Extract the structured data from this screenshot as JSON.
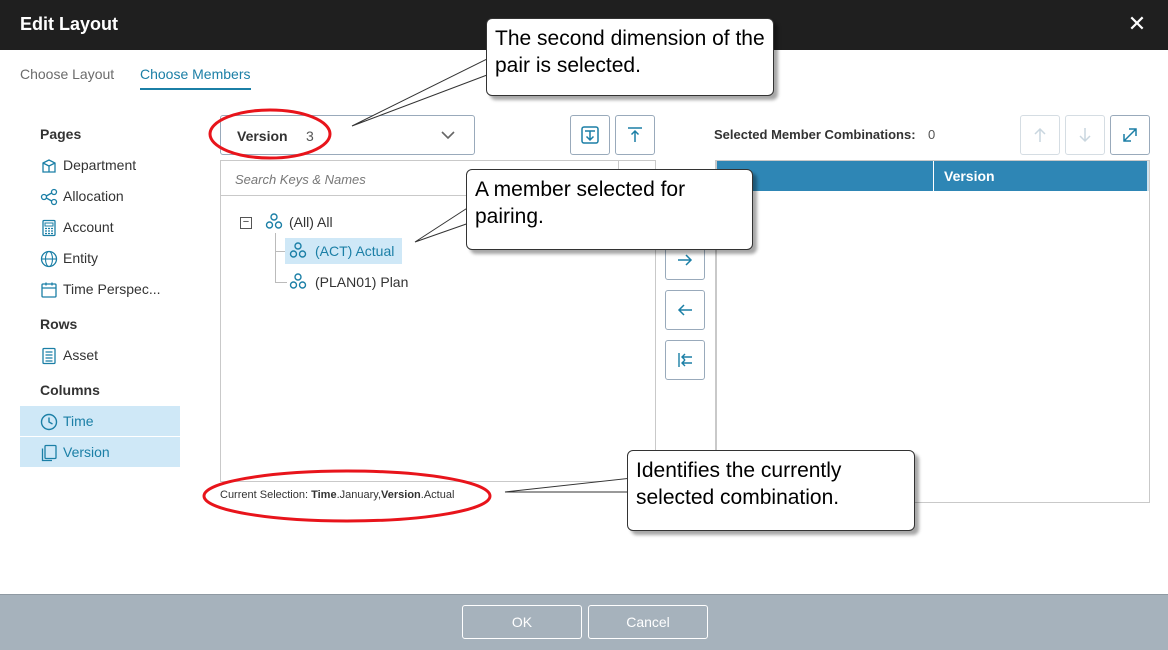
{
  "dialog": {
    "title": "Edit Layout",
    "close_glyph": "✕"
  },
  "tabs": {
    "choose_layout": "Choose Layout",
    "choose_members": "Choose Members"
  },
  "sidebar": {
    "pages_heading": "Pages",
    "pages": [
      {
        "label": "Department",
        "icon": "department-icon"
      },
      {
        "label": "Allocation",
        "icon": "allocation-icon"
      },
      {
        "label": "Account",
        "icon": "account-icon"
      },
      {
        "label": "Entity",
        "icon": "entity-icon"
      },
      {
        "label": "Time Perspec...",
        "icon": "calendar-icon"
      }
    ],
    "rows_heading": "Rows",
    "rows": [
      {
        "label": "Asset",
        "icon": "asset-icon"
      }
    ],
    "columns_heading": "Columns",
    "columns": [
      {
        "label": "Time",
        "icon": "clock-icon"
      },
      {
        "label": "Version",
        "icon": "version-icon"
      }
    ]
  },
  "dimension_dropdown": {
    "label": "Version",
    "count": "3"
  },
  "search": {
    "placeholder": "Search Keys & Names"
  },
  "tree": {
    "collapse_glyph": "−",
    "root": "(All) All",
    "children": [
      "(ACT) Actual",
      "(PLAN01) Plan"
    ]
  },
  "selected_combinations": {
    "label": "Selected Member Combinations:",
    "count": "0"
  },
  "grid": {
    "columns": [
      "",
      "Version"
    ]
  },
  "current_selection": {
    "prefix": "Current Selection: ",
    "dim1": "Time",
    "mem1": ".January,",
    "dim2": "Version",
    "mem2": ".Actual"
  },
  "footer": {
    "ok": "OK",
    "cancel": "Cancel"
  },
  "callouts": {
    "pair_selected": "The second dimension of the pair is selected.",
    "member_selected": "A member selected for pairing.",
    "identifies": "Identifies the currently selected combination."
  },
  "colors": {
    "accent": "#1b7fa6",
    "selection_bg": "#cfe8f7",
    "header_blue": "#2e86b5",
    "annotation_red": "#e8141b"
  }
}
